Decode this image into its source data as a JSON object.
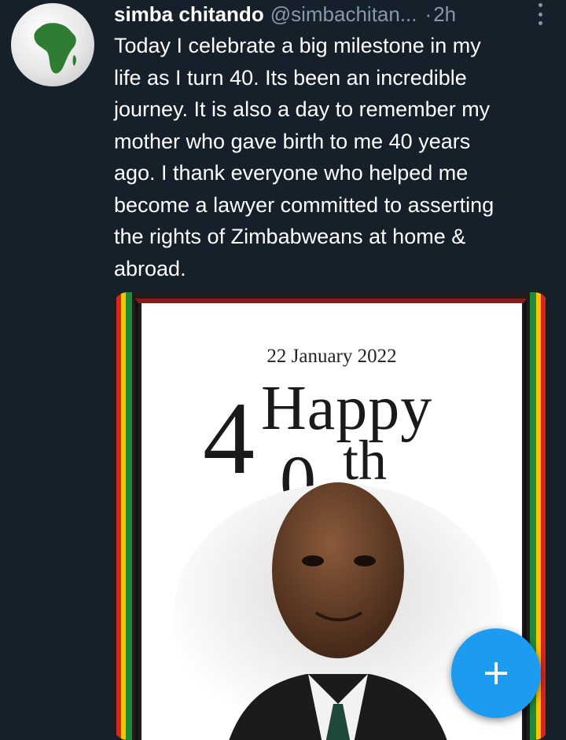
{
  "tweet": {
    "author_name": "simba chitando",
    "handle": "@simbachitan...",
    "separator": "·",
    "time": "2h",
    "text": "Today I celebrate a big milestone in my\nlife as I turn 40. Its been an incredible\njourney. It is also a day to remember my\nmother who gave birth to me 40 years\nago. I thank everyone who helped me\nbecome a lawyer committed to asserting\nthe rights of Zimbabweans at home &\nabroad."
  },
  "media": {
    "date": "22 January 2022",
    "big_number_first": "4",
    "big_number_second": "0",
    "word_happy": "Happy",
    "suffix_th": "th",
    "stripe_colors": [
      "#d7261e",
      "#f5c400",
      "#1f8a3a"
    ]
  },
  "icons": {
    "avatar": "africa-globe-icon",
    "more": "more-vertical-icon",
    "compose": "plus-icon"
  },
  "colors": {
    "background": "#15202b",
    "secondary_text": "#8899a6",
    "accent": "#1d9bf0"
  }
}
